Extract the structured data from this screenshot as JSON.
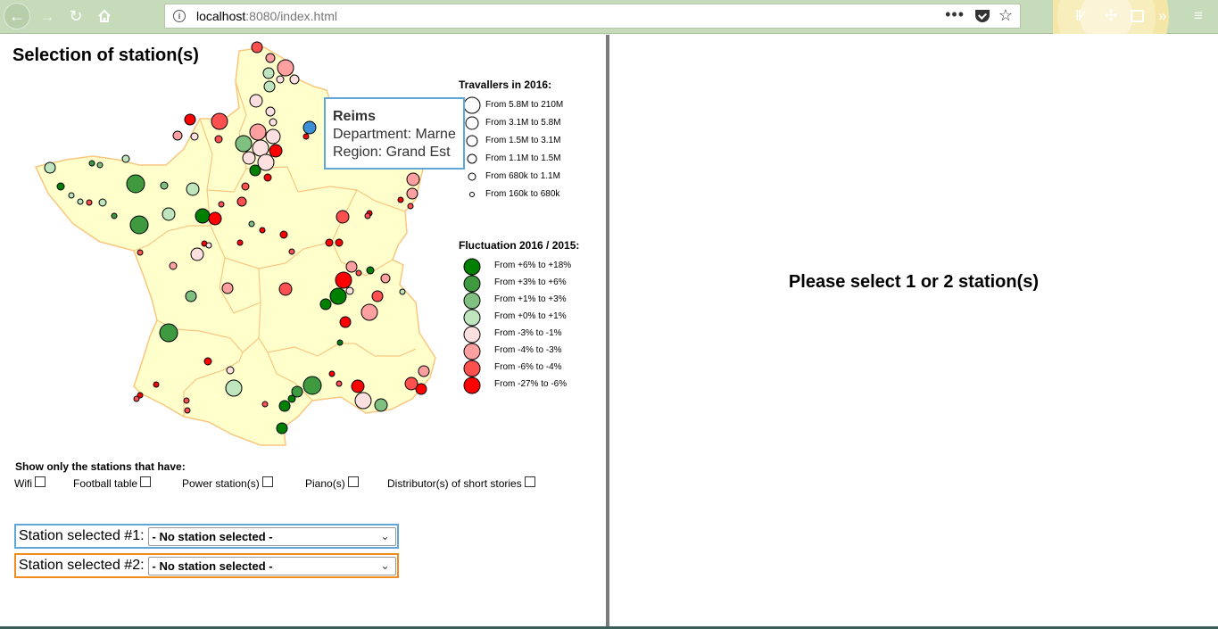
{
  "browser": {
    "url_host": "localhost",
    "url_rest": ":8080/index.html",
    "icons": [
      "back-arrow-icon",
      "forward-arrow-icon",
      "reload-icon",
      "home-icon",
      "info-icon",
      "menu-dots-icon",
      "pocket-icon",
      "bookmark-star-icon",
      "library-icon",
      "sync-icon",
      "sidebar-icon",
      "overflow-icon",
      "app-menu-icon"
    ]
  },
  "left": {
    "title": "Selection of station(s)",
    "tooltip": {
      "name": "Reims",
      "department": "Department: Marne",
      "region": "Region: Grand Est"
    },
    "legend_size": {
      "title": "Travallers in 2016:",
      "items": [
        "From 5.8M to 210M",
        "From 3.1M to 5.8M",
        "From 1.5M to 3.1M",
        "From 1.1M to 1.5M",
        "From 680k to 1.1M",
        "From 160k to 680k"
      ]
    },
    "legend_color": {
      "title": "Fluctuation 2016 / 2015:",
      "items": [
        {
          "label": "From +6% to +18%",
          "color": "#008000"
        },
        {
          "label": "From +3% to +6%",
          "color": "#3f9a3f"
        },
        {
          "label": "From +1% to +3%",
          "color": "#7fbf7f"
        },
        {
          "label": "From +0% to +1%",
          "color": "#bfe5bf"
        },
        {
          "label": "From -3% to -1%",
          "color": "#ffe0e0"
        },
        {
          "label": "From -4% to -3%",
          "color": "#ffa0a0"
        },
        {
          "label": "From -6% to -4%",
          "color": "#ff5050"
        },
        {
          "label": "From -27% to -6%",
          "color": "#ff0000"
        }
      ]
    },
    "filters": {
      "title": "Show only the stations that have:",
      "items": [
        "Wifi",
        "Football table",
        "Power station(s)",
        "Piano(s)",
        "Distributor(s) of short stories"
      ]
    },
    "selects": [
      {
        "label": "Station selected #1:",
        "value": "- No station selected -"
      },
      {
        "label": "Station selected #2:",
        "value": "- No station selected -"
      }
    ]
  },
  "right": {
    "prompt": "Please select 1 or 2 station(s)"
  }
}
